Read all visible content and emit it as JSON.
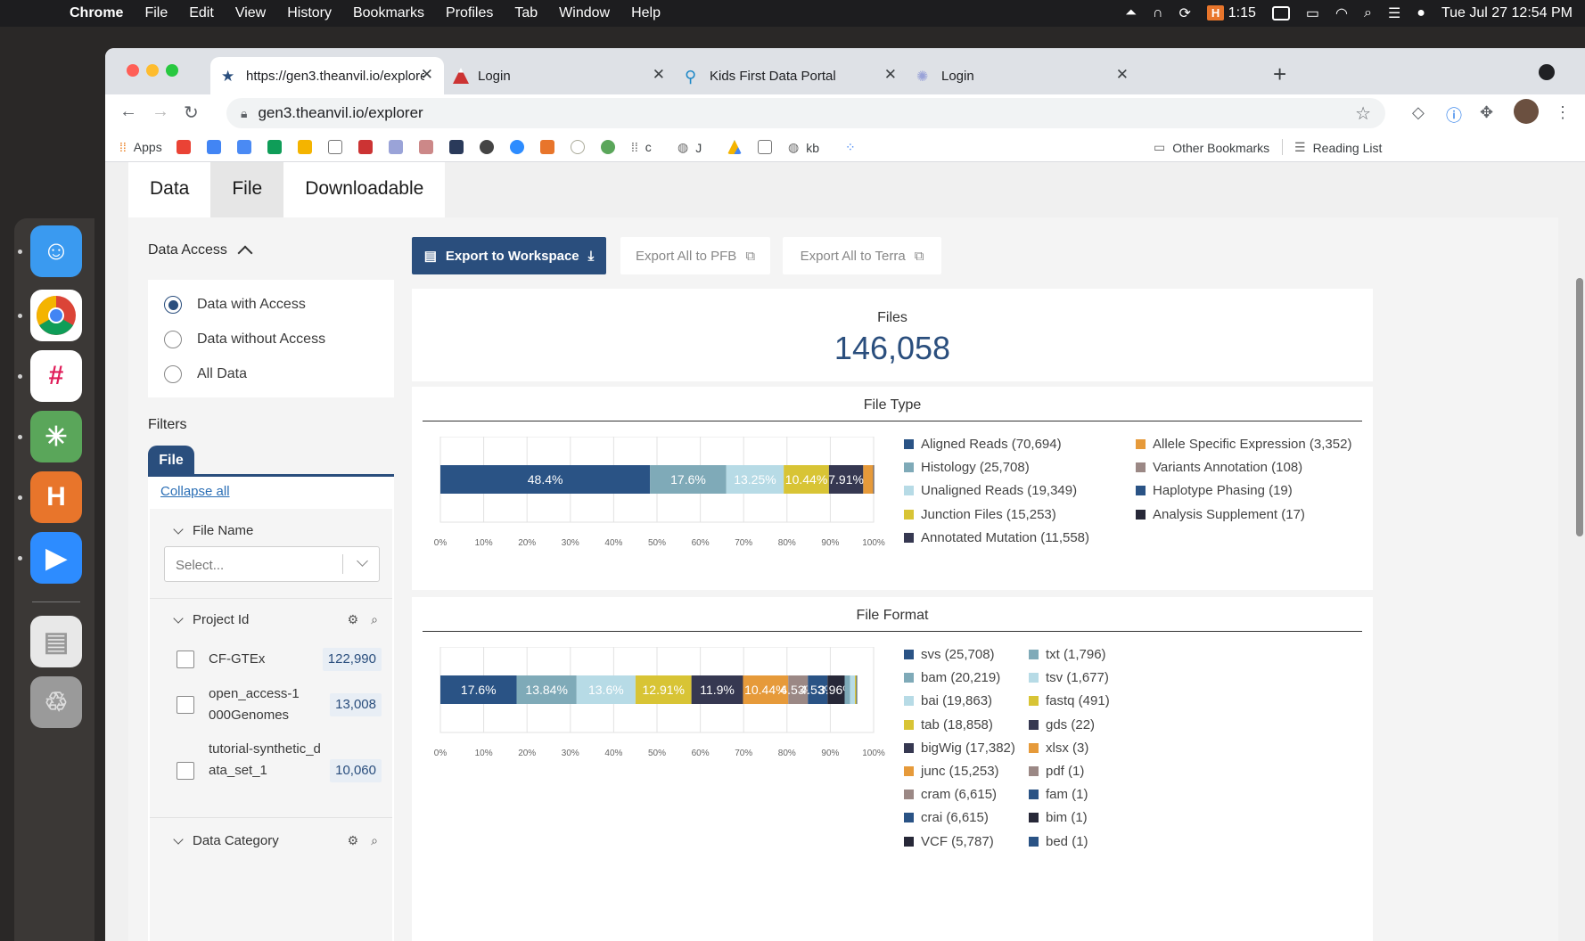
{
  "menubar": {
    "app": "Chrome",
    "items": [
      "File",
      "Edit",
      "View",
      "History",
      "Bookmarks",
      "Profiles",
      "Tab",
      "Window",
      "Help"
    ],
    "timer": "1:15",
    "datetime": "Tue Jul 27  12:54 PM"
  },
  "browser": {
    "tabs": [
      {
        "title": "https://gen3.theanvil.io/explorer",
        "active": true
      },
      {
        "title": "Login",
        "active": false
      },
      {
        "title": "Kids First Data Portal",
        "active": false
      },
      {
        "title": "Login",
        "active": false
      }
    ],
    "url": "gen3.theanvil.io/explorer",
    "bookmarks": [
      "Apps",
      "c",
      "J",
      "kb"
    ],
    "other_bookmarks": "Other Bookmarks",
    "reading_list": "Reading List"
  },
  "explorer_tabs": [
    "Data",
    "File",
    "Downloadable"
  ],
  "sidebar": {
    "access_title": "Data Access",
    "access_options": [
      "Data with Access",
      "Data without Access",
      "All Data"
    ],
    "filters_label": "Filters",
    "file_tab": "File",
    "collapse_all": "Collapse all",
    "file_name_facet": "File Name",
    "select_placeholder": "Select...",
    "project_facet": "Project Id",
    "projects": [
      {
        "name": "CF-GTEx",
        "count": "122,990"
      },
      {
        "name": "open_access-1000Genomes",
        "count": "13,008"
      },
      {
        "name": "tutorial-synthetic_data_set_1",
        "count": "10,060"
      }
    ],
    "data_category_facet": "Data Category"
  },
  "actions": {
    "export_workspace": "Export to Workspace",
    "export_pfb": "Export All to PFB",
    "export_terra": "Export All to Terra"
  },
  "summary": {
    "label": "Files",
    "count": "146,058"
  },
  "colors": {
    "accent": "#2a4e7d"
  },
  "chart_data": [
    {
      "type": "bar",
      "title": "File Type",
      "stacked": true,
      "orientation": "horizontal",
      "xlim": [
        0,
        100
      ],
      "xticks": [
        "0%",
        "10%",
        "20%",
        "30%",
        "40%",
        "50%",
        "60%",
        "70%",
        "80%",
        "90%",
        "100%"
      ],
      "series": [
        {
          "name": "Aligned Reads",
          "count": 70694,
          "percent": 48.4,
          "label": "48.4%",
          "color": "#2a5385"
        },
        {
          "name": "Histology",
          "count": 25708,
          "percent": 17.6,
          "label": "17.6%",
          "color": "#7faab8"
        },
        {
          "name": "Unaligned Reads",
          "count": 19349,
          "percent": 13.25,
          "label": "13.25%",
          "color": "#b7dbe6"
        },
        {
          "name": "Junction Files",
          "count": 15253,
          "percent": 10.44,
          "label": "10.44%",
          "color": "#d8c435"
        },
        {
          "name": "Annotated Mutation",
          "count": 11558,
          "percent": 7.91,
          "label": "7.91%",
          "color": "#363851"
        },
        {
          "name": "Allele Specific Expression",
          "count": 3352,
          "percent": 2.29,
          "label": "2.29%",
          "color": "#e69a3a"
        },
        {
          "name": "Variants Annotation",
          "count": 108,
          "percent": 0.07,
          "label": "",
          "color": "#9b8885"
        },
        {
          "name": "Haplotype Phasing",
          "count": 19,
          "percent": 0.01,
          "label": "",
          "color": "#2a5385"
        },
        {
          "name": "Analysis Supplement",
          "count": 17,
          "percent": 0.01,
          "label": "",
          "color": "#272838"
        }
      ],
      "legend": [
        "Aligned Reads  (70,694)",
        "Histology  (25,708)",
        "Unaligned Reads  (19,349)",
        "Junction Files  (15,253)",
        "Annotated Mutation  (11,558)",
        "Allele Specific Expression  (3,352)",
        "Variants Annotation  (108)",
        "Haplotype Phasing  (19)",
        "Analysis Supplement  (17)"
      ]
    },
    {
      "type": "bar",
      "title": "File Format",
      "stacked": true,
      "orientation": "horizontal",
      "xlim": [
        0,
        100
      ],
      "xticks": [
        "0%",
        "10%",
        "20%",
        "30%",
        "40%",
        "50%",
        "60%",
        "70%",
        "80%",
        "90%",
        "100%"
      ],
      "series": [
        {
          "name": "svs",
          "count": 25708,
          "percent": 17.6,
          "label": "17.6%",
          "color": "#2a5385"
        },
        {
          "name": "bam",
          "count": 20219,
          "percent": 13.84,
          "label": "13.84%",
          "color": "#7faab8"
        },
        {
          "name": "bai",
          "count": 19863,
          "percent": 13.6,
          "label": "13.6%",
          "color": "#b7dbe6"
        },
        {
          "name": "tab",
          "count": 18858,
          "percent": 12.91,
          "label": "12.91%",
          "color": "#d8c435"
        },
        {
          "name": "bigWig",
          "count": 17382,
          "percent": 11.9,
          "label": "11.9%",
          "color": "#363851"
        },
        {
          "name": "junc",
          "count": 15253,
          "percent": 10.44,
          "label": "10.44%",
          "color": "#e69a3a"
        },
        {
          "name": "cram",
          "count": 6615,
          "percent": 4.53,
          "label": "4.53%",
          "color": "#9b8885"
        },
        {
          "name": "crai",
          "count": 6615,
          "percent": 4.53,
          "label": "4.53%",
          "color": "#2a5385"
        },
        {
          "name": "VCF",
          "count": 5787,
          "percent": 3.96,
          "label": "3.96%",
          "color": "#272838"
        },
        {
          "name": "txt",
          "count": 1796,
          "percent": 1.23,
          "label": "1.23%",
          "color": "#7faab8"
        },
        {
          "name": "tsv",
          "count": 1677,
          "percent": 1.15,
          "label": "1.15%",
          "color": "#b7dbe6"
        },
        {
          "name": "fastq",
          "count": 491,
          "percent": 0.34,
          "label": "",
          "color": "#d8c435"
        },
        {
          "name": "gds",
          "count": 22,
          "percent": 0.02,
          "label": "",
          "color": "#363851"
        },
        {
          "name": "xlsx",
          "count": 3,
          "percent": 0.0,
          "label": "",
          "color": "#e69a3a"
        },
        {
          "name": "pdf",
          "count": 1,
          "percent": 0.0,
          "label": "",
          "color": "#9b8885"
        },
        {
          "name": "fam",
          "count": 1,
          "percent": 0.0,
          "label": "",
          "color": "#2a5385"
        },
        {
          "name": "bim",
          "count": 1,
          "percent": 0.0,
          "label": "",
          "color": "#272838"
        },
        {
          "name": "bed",
          "count": 1,
          "percent": 0.0,
          "label": "",
          "color": "#2a5385"
        }
      ],
      "legend": [
        "svs  (25,708)",
        "bam  (20,219)",
        "bai  (19,863)",
        "tab  (18,858)",
        "bigWig  (17,382)",
        "junc  (15,253)",
        "cram  (6,615)",
        "crai  (6,615)",
        "VCF  (5,787)",
        "txt  (1,796)",
        "tsv  (1,677)",
        "fastq  (491)",
        "gds  (22)",
        "xlsx  (3)",
        "pdf  (1)",
        "fam  (1)",
        "bim  (1)",
        "bed  (1)"
      ]
    }
  ]
}
